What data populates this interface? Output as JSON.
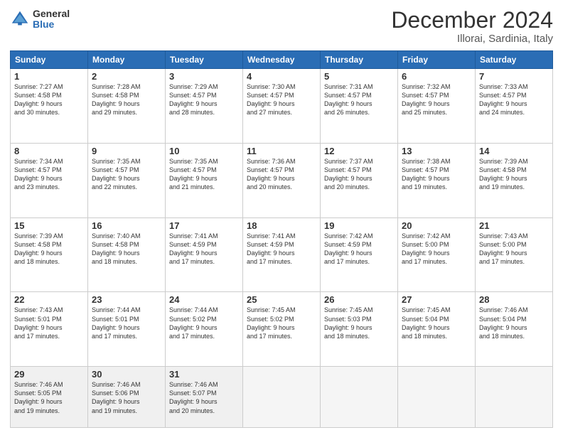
{
  "logo": {
    "general": "General",
    "blue": "Blue"
  },
  "header": {
    "month": "December 2024",
    "location": "Illorai, Sardinia, Italy"
  },
  "weekdays": [
    "Sunday",
    "Monday",
    "Tuesday",
    "Wednesday",
    "Thursday",
    "Friday",
    "Saturday"
  ],
  "weeks": [
    [
      {
        "day": "1",
        "info": "Sunrise: 7:27 AM\nSunset: 4:58 PM\nDaylight: 9 hours\nand 30 minutes."
      },
      {
        "day": "2",
        "info": "Sunrise: 7:28 AM\nSunset: 4:58 PM\nDaylight: 9 hours\nand 29 minutes."
      },
      {
        "day": "3",
        "info": "Sunrise: 7:29 AM\nSunset: 4:57 PM\nDaylight: 9 hours\nand 28 minutes."
      },
      {
        "day": "4",
        "info": "Sunrise: 7:30 AM\nSunset: 4:57 PM\nDaylight: 9 hours\nand 27 minutes."
      },
      {
        "day": "5",
        "info": "Sunrise: 7:31 AM\nSunset: 4:57 PM\nDaylight: 9 hours\nand 26 minutes."
      },
      {
        "day": "6",
        "info": "Sunrise: 7:32 AM\nSunset: 4:57 PM\nDaylight: 9 hours\nand 25 minutes."
      },
      {
        "day": "7",
        "info": "Sunrise: 7:33 AM\nSunset: 4:57 PM\nDaylight: 9 hours\nand 24 minutes."
      }
    ],
    [
      {
        "day": "8",
        "info": "Sunrise: 7:34 AM\nSunset: 4:57 PM\nDaylight: 9 hours\nand 23 minutes."
      },
      {
        "day": "9",
        "info": "Sunrise: 7:35 AM\nSunset: 4:57 PM\nDaylight: 9 hours\nand 22 minutes."
      },
      {
        "day": "10",
        "info": "Sunrise: 7:35 AM\nSunset: 4:57 PM\nDaylight: 9 hours\nand 21 minutes."
      },
      {
        "day": "11",
        "info": "Sunrise: 7:36 AM\nSunset: 4:57 PM\nDaylight: 9 hours\nand 20 minutes."
      },
      {
        "day": "12",
        "info": "Sunrise: 7:37 AM\nSunset: 4:57 PM\nDaylight: 9 hours\nand 20 minutes."
      },
      {
        "day": "13",
        "info": "Sunrise: 7:38 AM\nSunset: 4:57 PM\nDaylight: 9 hours\nand 19 minutes."
      },
      {
        "day": "14",
        "info": "Sunrise: 7:39 AM\nSunset: 4:58 PM\nDaylight: 9 hours\nand 19 minutes."
      }
    ],
    [
      {
        "day": "15",
        "info": "Sunrise: 7:39 AM\nSunset: 4:58 PM\nDaylight: 9 hours\nand 18 minutes."
      },
      {
        "day": "16",
        "info": "Sunrise: 7:40 AM\nSunset: 4:58 PM\nDaylight: 9 hours\nand 18 minutes."
      },
      {
        "day": "17",
        "info": "Sunrise: 7:41 AM\nSunset: 4:59 PM\nDaylight: 9 hours\nand 17 minutes."
      },
      {
        "day": "18",
        "info": "Sunrise: 7:41 AM\nSunset: 4:59 PM\nDaylight: 9 hours\nand 17 minutes."
      },
      {
        "day": "19",
        "info": "Sunrise: 7:42 AM\nSunset: 4:59 PM\nDaylight: 9 hours\nand 17 minutes."
      },
      {
        "day": "20",
        "info": "Sunrise: 7:42 AM\nSunset: 5:00 PM\nDaylight: 9 hours\nand 17 minutes."
      },
      {
        "day": "21",
        "info": "Sunrise: 7:43 AM\nSunset: 5:00 PM\nDaylight: 9 hours\nand 17 minutes."
      }
    ],
    [
      {
        "day": "22",
        "info": "Sunrise: 7:43 AM\nSunset: 5:01 PM\nDaylight: 9 hours\nand 17 minutes."
      },
      {
        "day": "23",
        "info": "Sunrise: 7:44 AM\nSunset: 5:01 PM\nDaylight: 9 hours\nand 17 minutes."
      },
      {
        "day": "24",
        "info": "Sunrise: 7:44 AM\nSunset: 5:02 PM\nDaylight: 9 hours\nand 17 minutes."
      },
      {
        "day": "25",
        "info": "Sunrise: 7:45 AM\nSunset: 5:02 PM\nDaylight: 9 hours\nand 17 minutes."
      },
      {
        "day": "26",
        "info": "Sunrise: 7:45 AM\nSunset: 5:03 PM\nDaylight: 9 hours\nand 18 minutes."
      },
      {
        "day": "27",
        "info": "Sunrise: 7:45 AM\nSunset: 5:04 PM\nDaylight: 9 hours\nand 18 minutes."
      },
      {
        "day": "28",
        "info": "Sunrise: 7:46 AM\nSunset: 5:04 PM\nDaylight: 9 hours\nand 18 minutes."
      }
    ],
    [
      {
        "day": "29",
        "info": "Sunrise: 7:46 AM\nSunset: 5:05 PM\nDaylight: 9 hours\nand 19 minutes."
      },
      {
        "day": "30",
        "info": "Sunrise: 7:46 AM\nSunset: 5:06 PM\nDaylight: 9 hours\nand 19 minutes."
      },
      {
        "day": "31",
        "info": "Sunrise: 7:46 AM\nSunset: 5:07 PM\nDaylight: 9 hours\nand 20 minutes."
      },
      {
        "day": "",
        "info": ""
      },
      {
        "day": "",
        "info": ""
      },
      {
        "day": "",
        "info": ""
      },
      {
        "day": "",
        "info": ""
      }
    ]
  ]
}
